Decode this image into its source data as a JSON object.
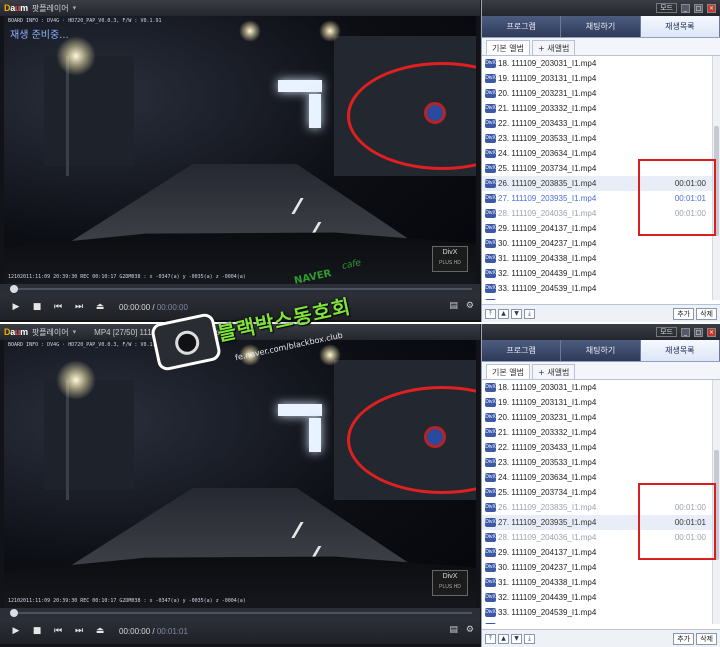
{
  "windows": [
    {
      "id": "top",
      "app_title": "팟플레이어",
      "file_info": "",
      "status_text": "재생 준비중...",
      "osd_top": "BOARD INFO : DV4G · HD720_PAP_V0.0.3, F/W : V0.1.91",
      "osd_bottom": "12102011:11:09     20:39:30  REC 00:10:17  G2DM038 : x -0347(a) y -0035(a) z -0004(a)",
      "time_current": "00:00:00",
      "time_total": "00:00:00",
      "seek_fraction": 0.0,
      "selected_index": 8,
      "current_index": 9,
      "gray_indices": [
        9,
        10
      ],
      "durations": {
        "8": "00:01:00",
        "9": "00:01:01",
        "10": "00:01:00"
      }
    },
    {
      "id": "bottom",
      "app_title": "팟플레이어",
      "file_info": "MP4  [27/50] 111109_203935_I1.mp4",
      "status_text": "",
      "osd_top": "BOARD INFO : DV4G · HD720_PAP_V0.0.3, F/W : V0.1.91",
      "osd_bottom": "12102011:11:09     20:39:30  REC 00:10:17  G2DM038 : x -0347(a) y -0035(a) z -0004(a)",
      "time_current": "00:00:00",
      "time_total": "00:01:01",
      "seek_fraction": 0.0,
      "selected_index": 9,
      "current_index": 9,
      "gray_indices": [
        8,
        10
      ],
      "durations": {
        "8": "00:01:00",
        "9": "00:01:01",
        "10": "00:01:00"
      }
    }
  ],
  "panel": {
    "mode_label": "모드",
    "tabs": [
      "프로그램",
      "채팅하기",
      "재생목록"
    ],
    "active_tab": 2,
    "subtabs": [
      "기본 앨범",
      "+ 새앨범"
    ],
    "add_label": "추가",
    "delete_label": "삭제",
    "badge_text": "DivX"
  },
  "playlist": [
    "18. 111109_203031_I1.mp4",
    "19. 111109_203131_I1.mp4",
    "20. 111109_203231_I1.mp4",
    "21. 111109_203332_I1.mp4",
    "22. 111109_203433_I1.mp4",
    "23. 111109_203533_I1.mp4",
    "24. 111109_203634_I1.mp4",
    "25. 111109_203734_I1.mp4",
    "26. 111109_203835_I1.mp4",
    "27. 111109_203935_I1.mp4",
    "28. 111109_204036_I1.mp4",
    "29. 111109_204137_I1.mp4",
    "30. 111109_204237_I1.mp4",
    "31. 111109_204338_I1.mp4",
    "32. 111109_204439_I1.mp4",
    "33. 111109_204539_I1.mp4",
    "34. 111109_204640_I1.mp4"
  ],
  "divx_logo": {
    "line1": "DivX",
    "line2": "PLUS HD"
  },
  "watermark": {
    "naver": "NAVER",
    "cafe": "cafe",
    "title": "블랙박스동호회",
    "url": "fe.naver.com/blackbox.club"
  },
  "colors": {
    "annotation_red": "#e02020",
    "accent_blue": "#3c59a8",
    "current_item_blue": "#4a6fd8"
  }
}
